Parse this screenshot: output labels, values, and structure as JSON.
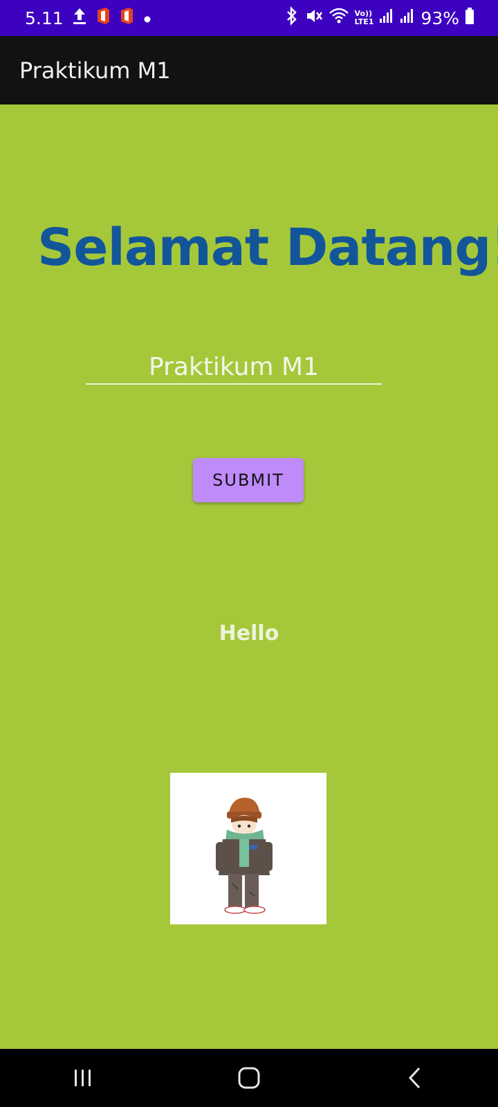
{
  "status_bar": {
    "time": "5.11",
    "battery": "93%",
    "icons": [
      "upload-icon",
      "office-icon",
      "office-icon",
      "dot-icon",
      "bluetooth-icon",
      "mute-icon",
      "wifi-icon",
      "volte-icon",
      "signal-icon",
      "signal-icon",
      "battery-icon"
    ],
    "volte_label": "Vo))",
    "lte_label": "LTE1"
  },
  "app_bar": {
    "title": "Praktikum M1"
  },
  "main": {
    "welcome_text": "Selamat Datang!",
    "name_input_value": "Praktikum M1",
    "submit_label": "SUBMIT",
    "hello_text": "Hello",
    "image_icon": "character-illustration"
  },
  "nav_bar": {
    "buttons": [
      "recent-apps-icon",
      "home-icon",
      "back-icon"
    ]
  },
  "colors": {
    "status_bar": "#3d02c0",
    "app_bar": "#121212",
    "background": "#a5c83b",
    "heading": "#125699",
    "button": "#bf8bfb",
    "nav_bar": "#000000"
  }
}
